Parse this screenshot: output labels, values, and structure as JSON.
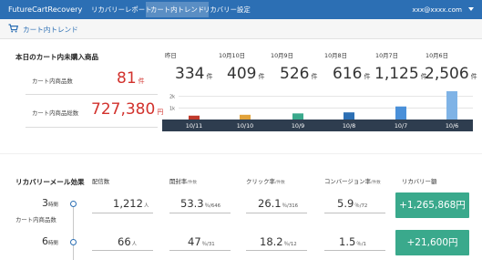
{
  "nav": {
    "brand": "FutureCartRecovery",
    "items": [
      "リカバリーレポート",
      "カート内トレンド",
      "リカバリー設定"
    ],
    "active_index": 1,
    "user": "xxx@xxxx.com"
  },
  "subheader": {
    "title": "カート内トレンド",
    "icon": "cart-icon"
  },
  "today": {
    "title": "本日のカート内未購入商品",
    "count_label": "カート内商品数",
    "count_value": "81",
    "count_unit": "件",
    "total_label": "カート内商品総数",
    "total_value": "727,380",
    "total_unit": "円"
  },
  "history": {
    "dates": [
      "昨日",
      "10月10日",
      "10月9日",
      "10月8日",
      "10月7日",
      "10月6日"
    ],
    "values": [
      "334",
      "409",
      "526",
      "616",
      "1,125",
      "2,506"
    ],
    "unit": "件"
  },
  "chart_data": {
    "type": "bar",
    "categories": [
      "10/11",
      "10/10",
      "10/9",
      "10/8",
      "10/7",
      "10/6"
    ],
    "values": [
      334,
      409,
      526,
      616,
      1125,
      2506
    ],
    "ytick_labels": [
      "2k",
      "1k"
    ],
    "ylim": [
      0,
      2600
    ],
    "colors": [
      "#c0392b",
      "#e2a33b",
      "#3aa98c",
      "#2c6fb4",
      "#4a90d9",
      "#7fb3e6"
    ]
  },
  "recovery": {
    "title": "リカバリーメール効果",
    "sub_label": "カート内商品数",
    "headers": {
      "sent": "配信数",
      "open": "開封率",
      "open_sub": "/件数",
      "click": "クリック率",
      "click_sub": "/件数",
      "conv": "コンバージョン率",
      "conv_sub": "/件数",
      "amount": "リカバリー額"
    },
    "rows": [
      {
        "period": "3",
        "period_unit": "時間",
        "sent": "1,212",
        "sent_unit": "人",
        "open": "53.3",
        "open_unit": "％/646",
        "click": "26.1",
        "click_unit": "％/316",
        "conv": "5.9",
        "conv_unit": "％/72",
        "amount": "+1,265,868円"
      },
      {
        "period": "6",
        "period_unit": "時間",
        "sent": "66",
        "sent_unit": "人",
        "open": "47",
        "open_unit": "％/31",
        "click": "18.2",
        "click_unit": "％/12",
        "conv": "1.5",
        "conv_unit": "％/1",
        "amount": "+21,600円"
      }
    ]
  }
}
